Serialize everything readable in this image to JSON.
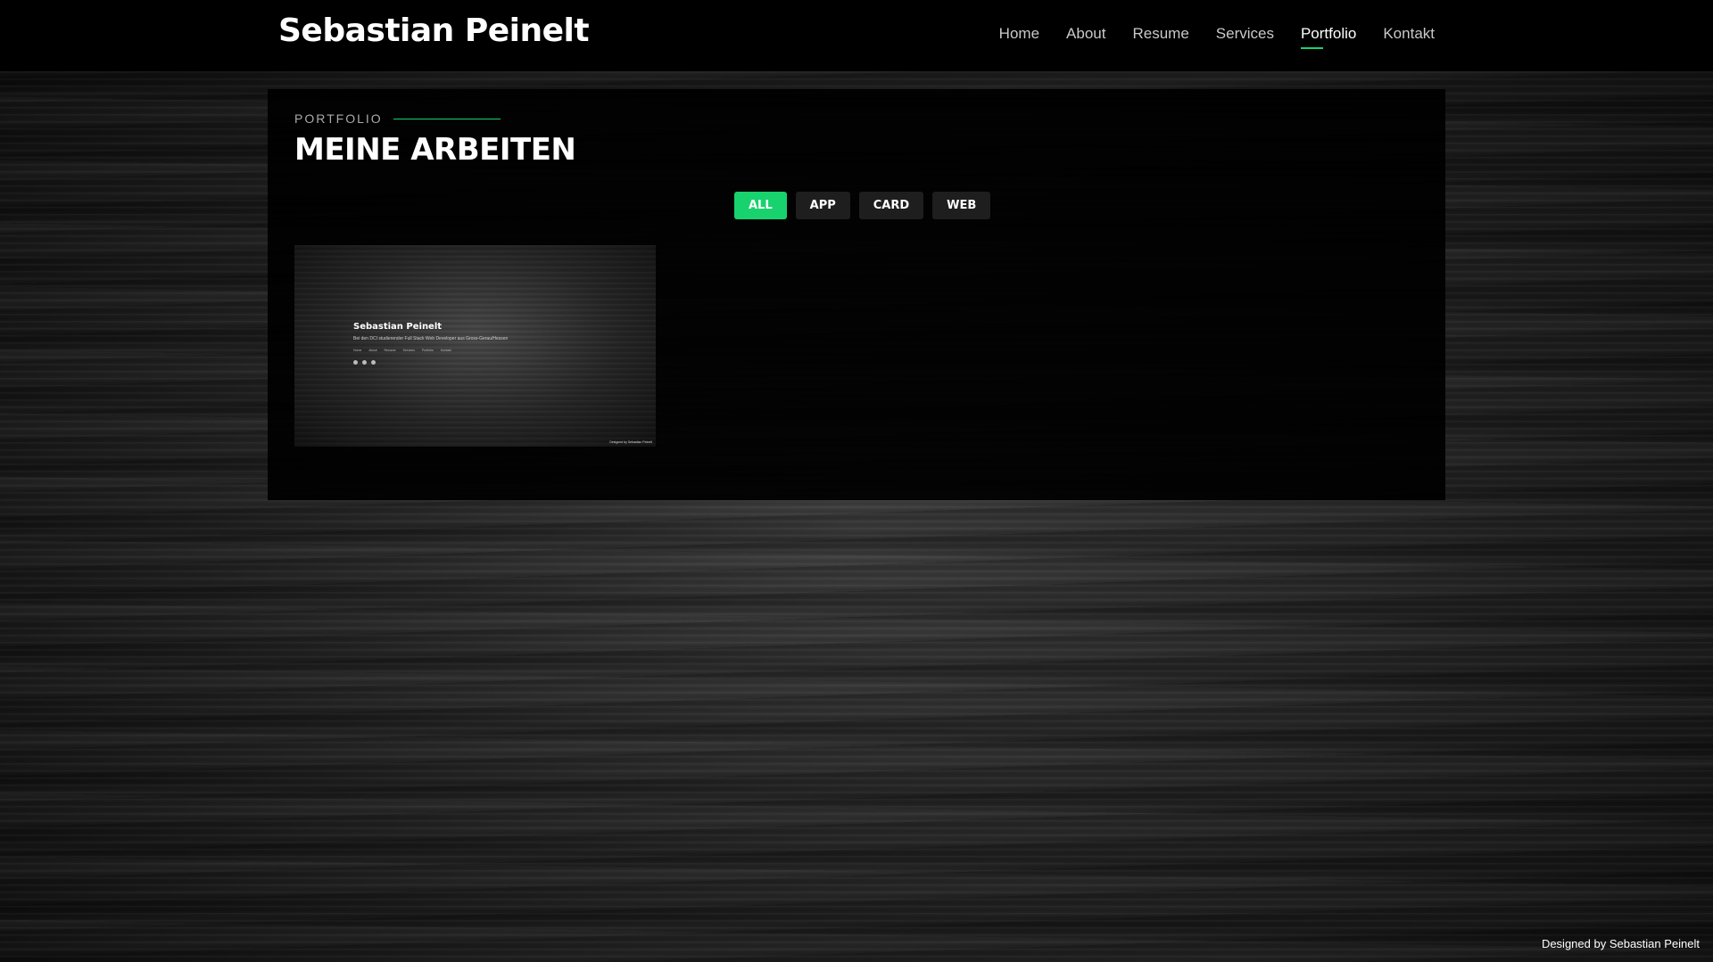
{
  "header": {
    "brand": "Sebastian Peinelt",
    "nav": [
      {
        "label": "Home"
      },
      {
        "label": "About"
      },
      {
        "label": "Resume"
      },
      {
        "label": "Services"
      },
      {
        "label": "Portfolio",
        "active": true
      },
      {
        "label": "Kontakt"
      }
    ]
  },
  "portfolio": {
    "label": "PORTFOLIO",
    "title": "MEINE ARBEITEN",
    "filters": [
      {
        "label": "ALL",
        "active": true
      },
      {
        "label": "APP"
      },
      {
        "label": "CARD"
      },
      {
        "label": "WEB"
      }
    ],
    "items": [
      {
        "preview_name": "Sebastian Peinelt",
        "preview_subtitle": "Bei den DCI studierender Full Stack Web Developer aus Gross-Gerau/Hessen",
        "preview_nav": [
          "Home",
          "About",
          "Resume",
          "Services",
          "Portfolio",
          "Kontakt"
        ],
        "preview_footer": "Designed by Sebastian Peinelt"
      }
    ]
  },
  "footer": {
    "credit": "Designed by Sebastian Peinelt"
  },
  "colors": {
    "accent": "#18d26e",
    "header_bg": "#000000",
    "panel_bg": "#000000",
    "filter_bg": "#1e1e1e"
  }
}
